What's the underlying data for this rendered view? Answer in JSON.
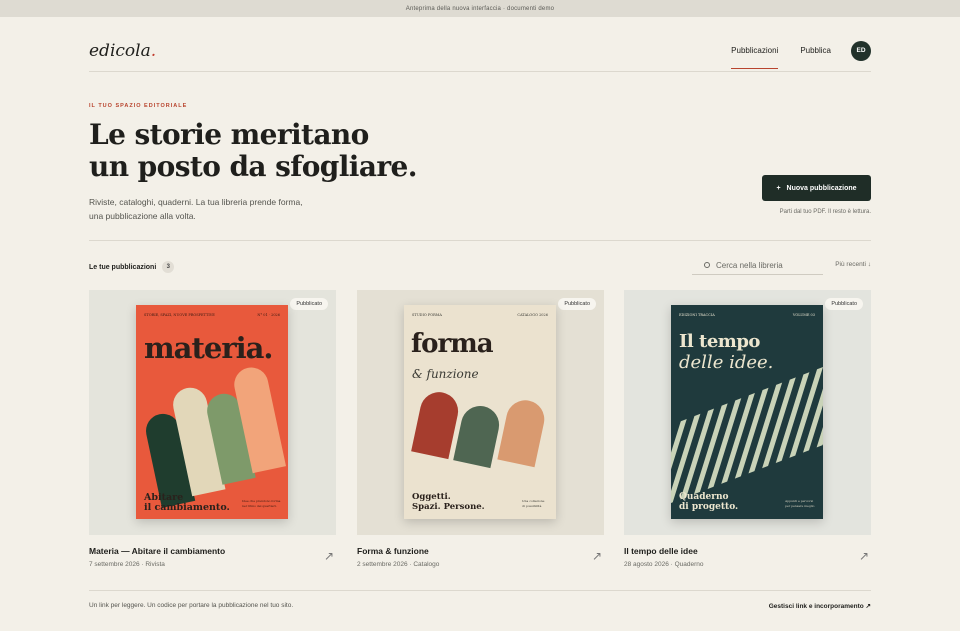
{
  "banner": "Anteprima della nuova interfaccia · documenti demo",
  "brand": {
    "name": "edicola",
    "dot": "."
  },
  "nav": {
    "items": [
      "Pubblicazioni",
      "Pubblica"
    ],
    "active": "Pubblicazioni",
    "avatar": "ED"
  },
  "hero": {
    "eyebrow": "IL TUO SPAZIO EDITORIALE",
    "title_line1": "Le storie meritano",
    "title_line2": "un posto da sfogliare.",
    "subtitle_line1": "Riviste, cataloghi, quaderni. La tua libreria prende forma,",
    "subtitle_line2": "una pubblicazione alla volta.",
    "cta_icon": "+",
    "cta_label": "Nuova pubblicazione",
    "cta_note": "Parti dal tuo PDF. Il resto è lettura."
  },
  "library": {
    "title": "Le tue pubblicazioni",
    "count": "3",
    "search_placeholder": "Cerca nella libreria",
    "sort_label": "Più recenti ↓",
    "cards": [
      {
        "badge": "Pubblicato",
        "title": "Materia — Abitare il cambiamento",
        "meta": "7 settembre 2026 · Rivista",
        "cover_header_left": "STORIE, SPAZI, NUOVE PROSPETTIVE",
        "cover_header_right": "N° 01 · 2026",
        "cover_title": "materia.",
        "cover_footer_line1": "Abitare",
        "cover_footer_line2": "il cambiamento.",
        "cover_note_line1": "Idee che prendono forma",
        "cover_note_line2": "nel ritmo dei quartieri.",
        "bg": "#e4e4dc",
        "cover_color": "#e8593c"
      },
      {
        "badge": "Pubblicato",
        "title": "Forma & funzione",
        "meta": "2 settembre 2026 · Catalogo",
        "cover_header_left": "STUDIO FORMA",
        "cover_header_right": "CATALOGO 2026",
        "cover_title": "forma",
        "cover_subtitle": "& funzione",
        "cover_footer_line1": "Oggetti.",
        "cover_footer_line2": "Spazi. Persone.",
        "cover_note_line1": "Una collezione",
        "cover_note_line2": "di possibilità",
        "bg": "#e4e0d4",
        "cover_color": "#ebe2cf"
      },
      {
        "badge": "Pubblicato",
        "title": "Il tempo delle idee",
        "meta": "28 agosto 2026 · Quaderno",
        "cover_header_left": "EDIZIONI TRACCIA",
        "cover_header_right": "VOLUME 03",
        "cover_title_line1": "Il tempo",
        "cover_title_line2": "delle idee.",
        "cover_footer_line1": "Quaderno",
        "cover_footer_line2": "di progetto.",
        "cover_note_line1": "Appunti e percorsi",
        "cover_note_line2": "per pensare meglio",
        "bg": "#e3e4de",
        "cover_color": "#1f3a3d"
      }
    ]
  },
  "footer": {
    "left": "Un link per leggere. Un codice per portare la pubblicazione nel tuo sito.",
    "right": "Gestisci link e incorporamento ↗"
  },
  "icons": {
    "arrow": "arrow-up-right-icon",
    "search": "search-icon",
    "plus": "plus-icon"
  },
  "colors": {
    "accent": "#b8442e",
    "dark": "#1f2d27",
    "background": "#f3f0e8"
  }
}
